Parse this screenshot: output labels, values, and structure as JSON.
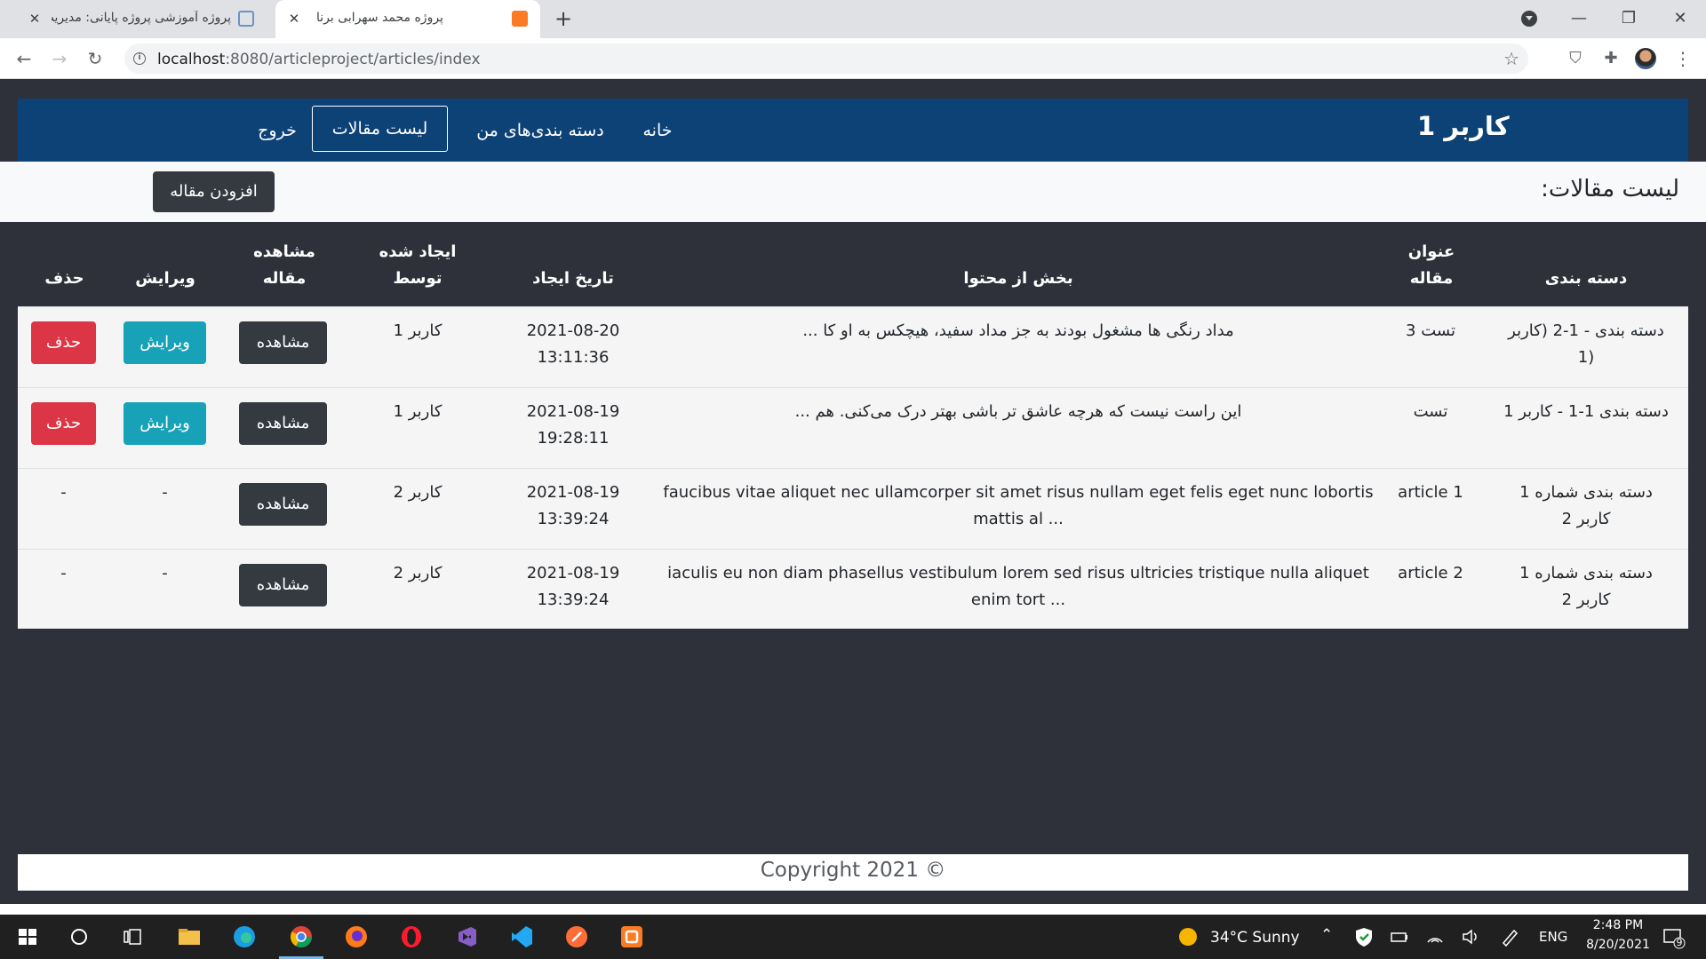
{
  "browser": {
    "tabs": [
      {
        "title": "پروژه آموزشی پروژه پایانی: مدیریت ..",
        "active": false
      },
      {
        "title": "پروژه محمد سهرابی برنا",
        "active": true
      }
    ],
    "url_host": "localhost",
    "url_rest": ":8080/articleproject/articles/index"
  },
  "site": {
    "brand": "کاربر 1",
    "menu": {
      "home": "خانه",
      "my_categories": "دسته بندی‌های من",
      "articles": "لیست مقالات",
      "logout": "خروج"
    },
    "page_title": "لیست مقالات:",
    "add_button": "افزودن مقاله"
  },
  "table": {
    "headers": {
      "category": "دسته بندی",
      "title_line1": "عنوان",
      "title_line2": "مقاله",
      "excerpt": "بخش از محتوا",
      "created_at": "تاریخ ایجاد",
      "created_by_line1": "ایجاد شده",
      "created_by_line2": "توسط",
      "view_line1": "مشاهده",
      "view_line2": "مقاله",
      "edit": "ویرایش",
      "delete": "حذف"
    },
    "rows": [
      {
        "category_line1": "دسته بندی - 1-2 (کاربر",
        "category_line2": "(1",
        "title": "تست 3",
        "excerpt_line1": "مداد رنگی ها مشغول بودند به جز مداد سفید، هیچکس به او کا ...",
        "excerpt_line2": "",
        "date": "2021-08-20",
        "time": "13:11:36",
        "author": "کاربر 1",
        "view": "مشاهده",
        "edit": "ویرایش",
        "delete": "حذف"
      },
      {
        "category_line1": "دسته بندی 1-1 - کاربر 1",
        "category_line2": "",
        "title": "تست",
        "excerpt_line1": "این راست نیست که هرچه عاشق تر باشی بهتر درک می‌کنی. هم ...",
        "excerpt_line2": "",
        "date": "2021-08-19",
        "time": "19:28:11",
        "author": "کاربر 1",
        "view": "مشاهده",
        "edit": "ویرایش",
        "delete": "حذف"
      },
      {
        "category_line1": "دسته بندی شماره 1",
        "category_line2": "کاربر 2",
        "title": "article 1",
        "excerpt_line1": "faucibus vitae aliquet nec ullamcorper sit amet risus nullam eget felis eget nunc lobortis",
        "excerpt_line2": "mattis al ...",
        "date": "2021-08-19",
        "time": "13:39:24",
        "author": "کاربر 2",
        "view": "مشاهده",
        "edit": "-",
        "delete": "-"
      },
      {
        "category_line1": "دسته بندی شماره 1",
        "category_line2": "کاربر 2",
        "title": "article 2",
        "excerpt_line1": "iaculis eu non diam phasellus vestibulum lorem sed risus ultricies tristique nulla aliquet",
        "excerpt_line2": "enim tort ...",
        "date": "2021-08-19",
        "time": "13:39:24",
        "author": "کاربر 2",
        "view": "مشاهده",
        "edit": "-",
        "delete": "-"
      }
    ]
  },
  "footer": {
    "copyright": "Copyright 2021 ©"
  },
  "taskbar": {
    "weather": "34°C  Sunny",
    "language": "ENG",
    "time": "2:48 PM",
    "date": "8/20/2021",
    "notifications": "9"
  },
  "colors": {
    "header": "#0d4277",
    "page_bg": "#2e3139",
    "view_button": "#343a40",
    "edit_button": "#17a2b8",
    "delete_button": "#dc3545"
  }
}
